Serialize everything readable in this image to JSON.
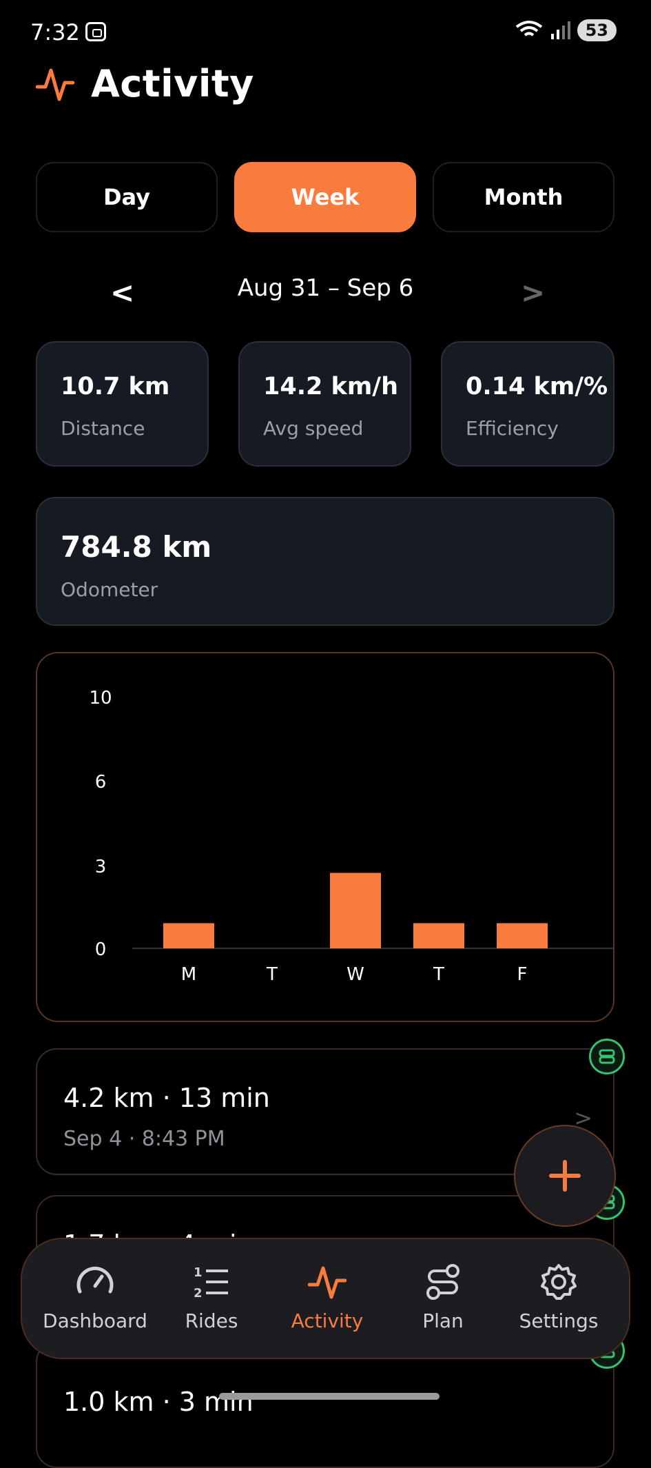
{
  "status_bar": {
    "time": "7:32",
    "battery": "53"
  },
  "header": {
    "title": "Activity"
  },
  "segments": [
    {
      "label": "Day",
      "active": false
    },
    {
      "label": "Week",
      "active": true
    },
    {
      "label": "Month",
      "active": false
    }
  ],
  "range": {
    "label": "Aug 31 – Sep 6",
    "prev": "<",
    "next": ">"
  },
  "stats": [
    {
      "value": "10.7 km",
      "label": "Distance"
    },
    {
      "value": "14.2 km/h",
      "label": "Avg speed"
    },
    {
      "value": "0.14 km/%",
      "label": "Efficiency"
    }
  ],
  "odometer": {
    "value": "784.8 km",
    "label": "Odometer"
  },
  "chart_data": {
    "type": "bar",
    "categories": [
      "M",
      "T",
      "W",
      "T",
      "F"
    ],
    "values": [
      1,
      0,
      3,
      1,
      1
    ],
    "yticks": [
      "10",
      "6",
      "3",
      "0"
    ],
    "ylim": [
      0,
      10
    ],
    "color": "#f97b3d",
    "grid": false
  },
  "rides": [
    {
      "main": "4.2 km · 13 min",
      "sub": "Sep 4 · 8:43 PM",
      "chevron": ">"
    },
    {
      "main": "1.7 km · 4 min",
      "sub": ""
    },
    {
      "main": "1.0 km · 3 min",
      "sub": ""
    }
  ],
  "fab": {
    "icon": "plus-icon"
  },
  "nav": [
    {
      "label": "Dashboard",
      "icon": "speedometer-icon",
      "active": false
    },
    {
      "label": "Rides",
      "icon": "numbered-list-icon",
      "active": false
    },
    {
      "label": "Activity",
      "icon": "activity-pulse-icon",
      "active": true
    },
    {
      "label": "Plan",
      "icon": "route-icon",
      "active": false
    },
    {
      "label": "Settings",
      "icon": "gear-icon",
      "active": false
    }
  ],
  "colors": {
    "accent": "#f97b3d",
    "card": "#161a22",
    "success": "#38c172"
  }
}
